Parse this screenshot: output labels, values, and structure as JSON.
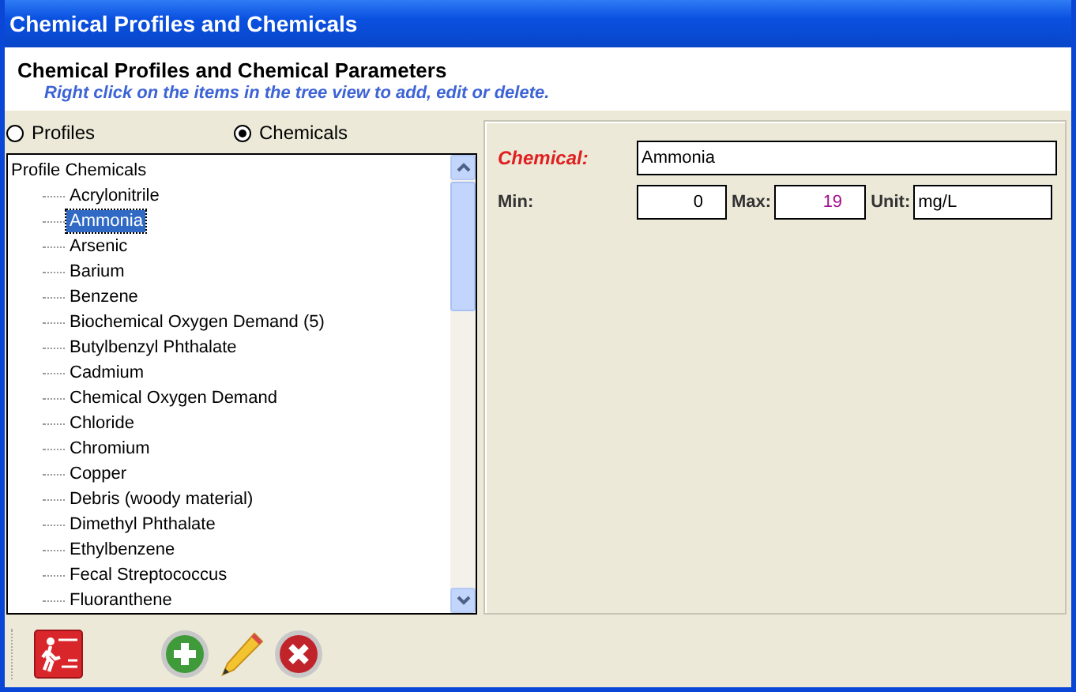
{
  "window": {
    "title": "Chemical Profiles and Chemicals"
  },
  "header": {
    "title": "Chemical Profiles and Chemical Parameters",
    "hint": "Right click on the items in the tree view to add, edit or delete."
  },
  "view_options": [
    {
      "label": "Profiles",
      "selected": false
    },
    {
      "label": "Chemicals",
      "selected": true
    }
  ],
  "tree": {
    "label": "Profile Chemicals",
    "children": [
      {
        "label": "Acrylonitrile",
        "selected": false
      },
      {
        "label": "Ammonia",
        "selected": true
      },
      {
        "label": "Arsenic",
        "selected": false
      },
      {
        "label": "Barium",
        "selected": false
      },
      {
        "label": "Benzene",
        "selected": false
      },
      {
        "label": "Biochemical Oxygen Demand (5)",
        "selected": false
      },
      {
        "label": "Butylbenzyl Phthalate",
        "selected": false
      },
      {
        "label": "Cadmium",
        "selected": false
      },
      {
        "label": "Chemical Oxygen Demand",
        "selected": false
      },
      {
        "label": "Chloride",
        "selected": false
      },
      {
        "label": "Chromium",
        "selected": false
      },
      {
        "label": "Copper",
        "selected": false
      },
      {
        "label": "Debris (woody material)",
        "selected": false
      },
      {
        "label": "Dimethyl Phthalate",
        "selected": false
      },
      {
        "label": "Ethylbenzene",
        "selected": false
      },
      {
        "label": "Fecal Streptococcus",
        "selected": false
      },
      {
        "label": "Fluoranthene",
        "selected": false
      }
    ]
  },
  "details": {
    "chemical": {
      "label": "Chemical:",
      "value": "Ammonia"
    },
    "min": {
      "label": "Min:",
      "value": "0"
    },
    "max": {
      "label": "Max:",
      "value": "19"
    },
    "unit": {
      "label": "Unit:",
      "value": "mg/L"
    }
  }
}
